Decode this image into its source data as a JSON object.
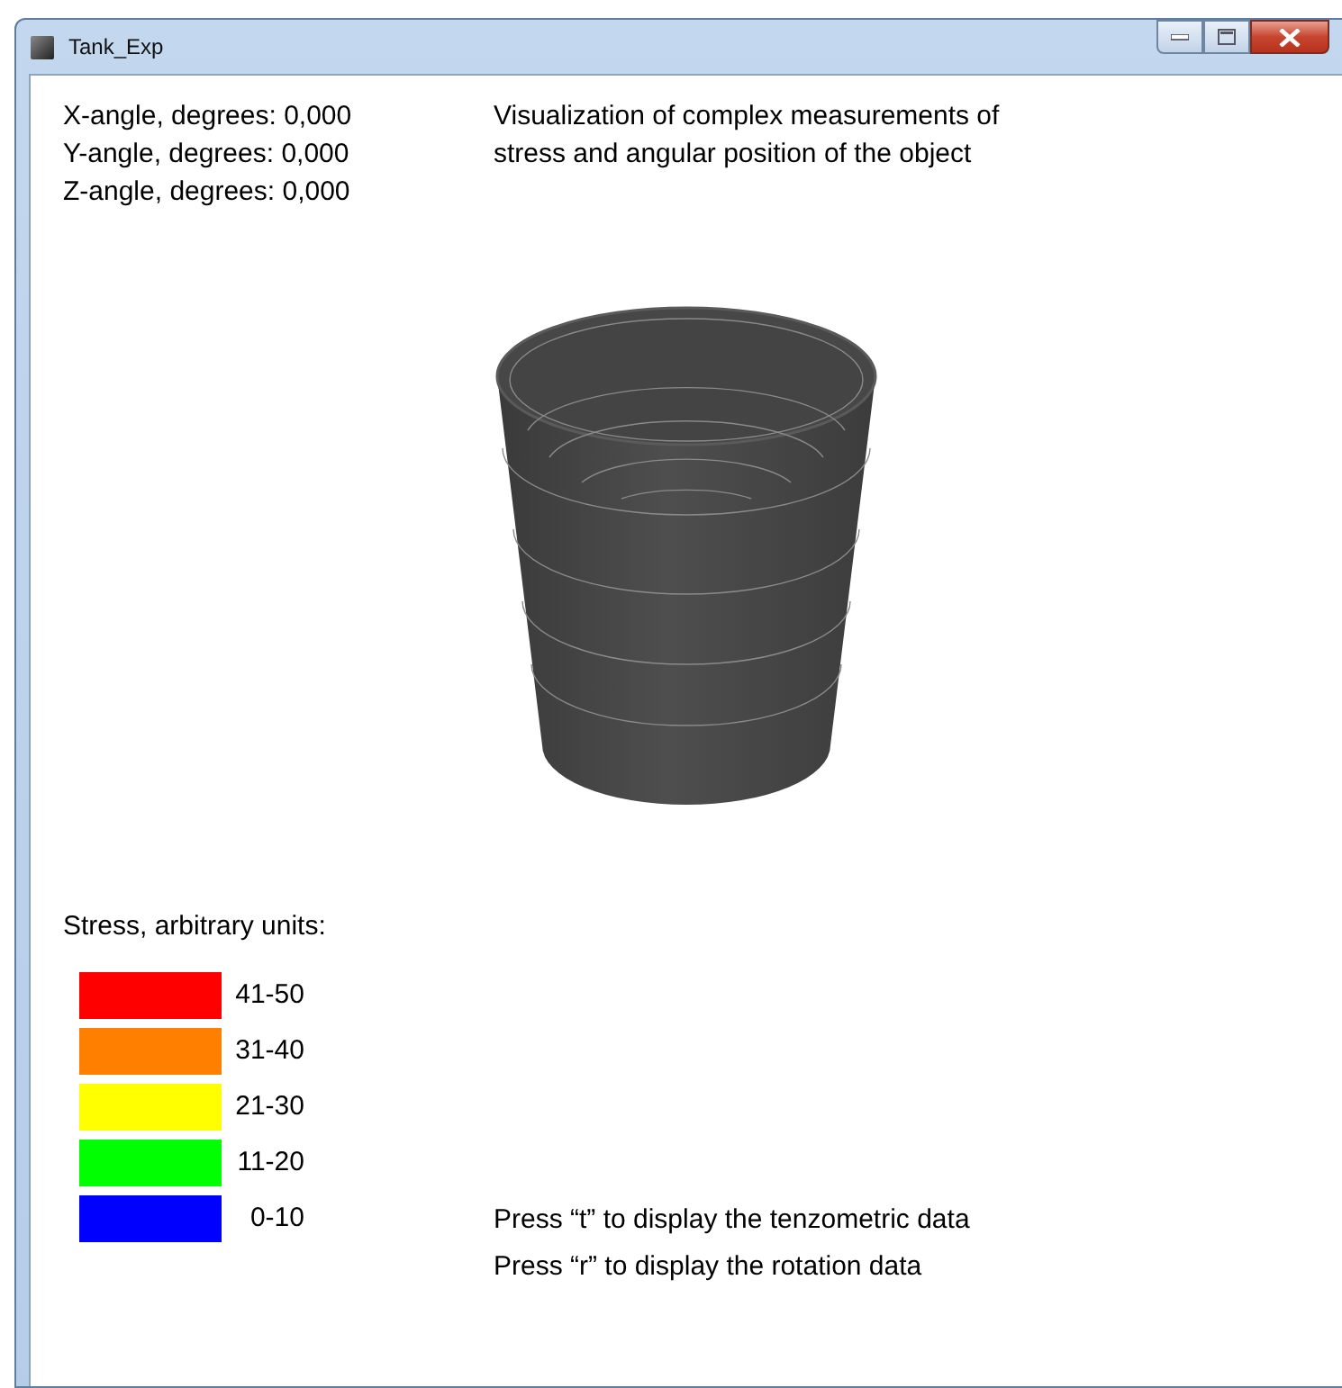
{
  "window": {
    "title": "Tank_Exp"
  },
  "angles": [
    "X-angle, degrees: 0,000",
    "Y-angle, degrees: 0,000",
    "Z-angle, degrees: 0,000"
  ],
  "description": [
    "Visualization of complex measurements of",
    "stress and angular position of the object"
  ],
  "legend": {
    "title": "Stress, arbitrary units:",
    "items": [
      {
        "label": "41-50",
        "color": "#ff0000"
      },
      {
        "label": "31-40",
        "color": "#ff8000"
      },
      {
        "label": "21-30",
        "color": "#ffff00"
      },
      {
        "label": "11-20",
        "color": "#00ff00"
      },
      {
        "label": "0-10",
        "color": "#0000ff"
      }
    ]
  },
  "hints": [
    "Press “t” to display the tenzometric data",
    "Press “r” to display the rotation data"
  ]
}
